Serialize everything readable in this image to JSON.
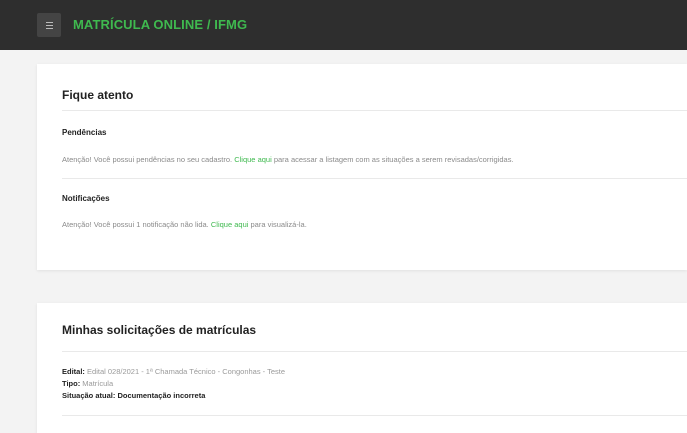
{
  "header": {
    "brand": "MATRÍCULA ONLINE / IFMG",
    "menu_icon": "hamburger-menu-icon"
  },
  "alerts_card": {
    "title": "Fique atento",
    "pendencias": {
      "title": "Pendências",
      "text_before": "Atenção! Você possui pendências no seu cadastro.",
      "link": "Clique aqui",
      "text_after": "para acessar a listagem com as situações a serem revisadas/corrigidas."
    },
    "notificacoes": {
      "title": "Notificações",
      "text_before": "Atenção! Você possui 1 notificação não lida.",
      "link": "Clique aqui",
      "text_after": "para visualizá-la."
    }
  },
  "requests_card": {
    "title": "Minhas solicitações de matrículas",
    "edital_label": "Edital:",
    "edital_value": "Edital 028/2021 - 1ª Chamada Técnico - Congonhas - Teste",
    "tipo_label": "Tipo:",
    "tipo_value": "Matrícula",
    "situacao_label": "Situação atual:",
    "situacao_value": "Documentação incorreta"
  },
  "colors": {
    "accent_green": "#3fb94f",
    "topbar": "#2e2e2e",
    "background": "#f3f3f3"
  }
}
